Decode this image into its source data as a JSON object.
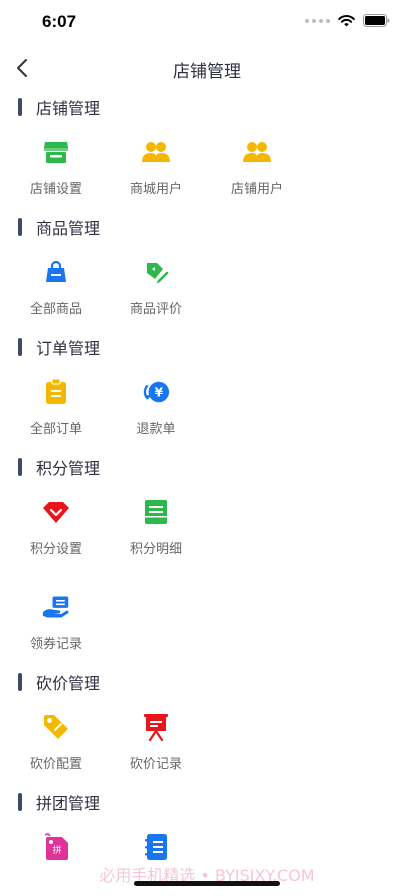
{
  "status_bar": {
    "time": "6:07"
  },
  "nav": {
    "title": "店铺管理"
  },
  "sections": [
    {
      "title": "店铺管理",
      "items": [
        {
          "label": "店铺设置",
          "icon": "store-icon",
          "color": "#2db84c"
        },
        {
          "label": "商城用户",
          "icon": "users-icon",
          "color": "#f5b800"
        },
        {
          "label": "店铺用户",
          "icon": "users-icon",
          "color": "#f5b800"
        }
      ]
    },
    {
      "title": "商品管理",
      "items": [
        {
          "label": "全部商品",
          "icon": "shopping-bag-icon",
          "color": "#1976f0"
        },
        {
          "label": "商品评价",
          "icon": "review-tag-icon",
          "color": "#2db84c"
        }
      ]
    },
    {
      "title": "订单管理",
      "items": [
        {
          "label": "全部订单",
          "icon": "clipboard-icon",
          "color": "#f5b800"
        },
        {
          "label": "退款单",
          "icon": "refund-yuan-icon",
          "color": "#1976f0"
        }
      ]
    },
    {
      "title": "积分管理",
      "items": [
        {
          "label": "积分设置",
          "icon": "diamond-icon",
          "color": "#e8151b"
        },
        {
          "label": "积分明细",
          "icon": "points-detail-icon",
          "color": "#2db84c"
        },
        {
          "label": "领券记录",
          "icon": "coupon-hand-icon",
          "color": "#1976f0"
        }
      ]
    },
    {
      "title": "砍价管理",
      "items": [
        {
          "label": "砍价配置",
          "icon": "price-tag-icon",
          "color": "#f5b800"
        },
        {
          "label": "砍价记录",
          "icon": "presentation-board-icon",
          "color": "#e8151b"
        }
      ]
    },
    {
      "title": "拼团管理",
      "items": [
        {
          "label": "",
          "icon": "group-buy-tag-icon",
          "color": "#e0339a"
        },
        {
          "label": "",
          "icon": "notebook-icon",
          "color": "#1976f0"
        }
      ]
    }
  ],
  "watermark": "必用手机精选 • BYJSJXY.COM"
}
